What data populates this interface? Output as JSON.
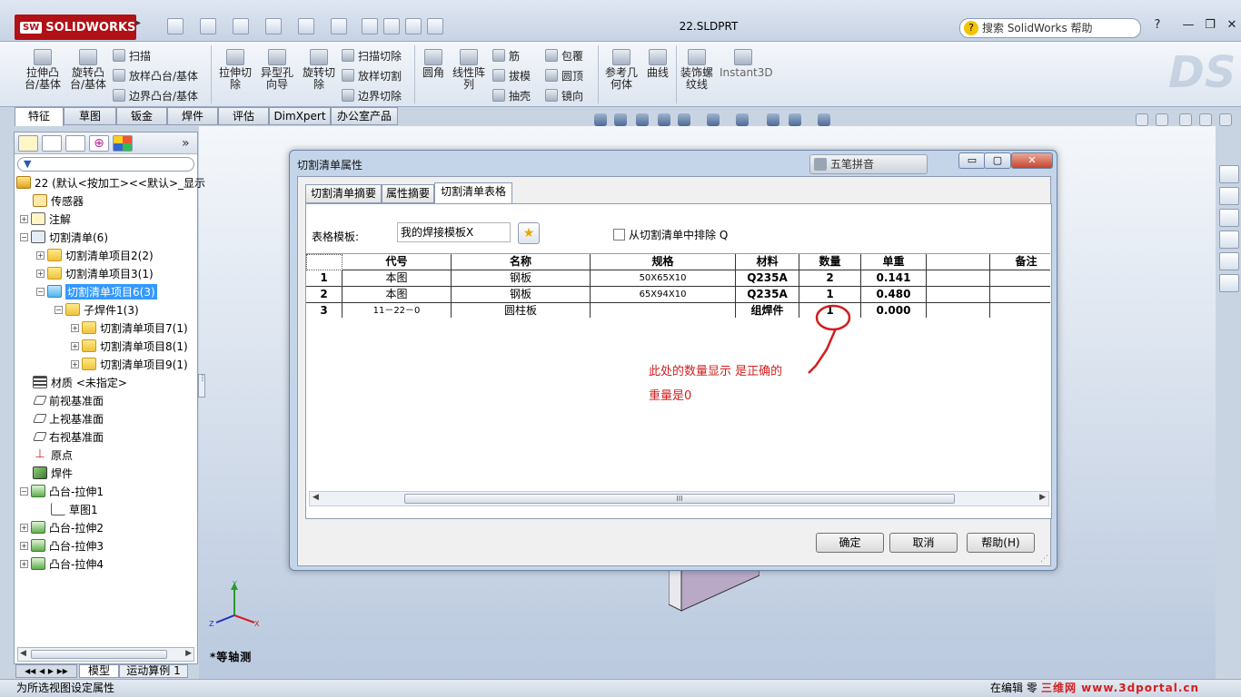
{
  "app": {
    "logo": "SOLIDWORKS",
    "logo_mark": "SW",
    "document_title": "22.SLDPRT",
    "help_search_placeholder": "搜索 SolidWorks 帮助",
    "help_glyph": "?",
    "window_controls": [
      "—",
      "❐",
      "✕"
    ]
  },
  "command_manager": {
    "large": [
      {
        "label1": "拉伸凸",
        "label2": "台/基体"
      },
      {
        "label1": "旋转凸",
        "label2": "台/基体"
      },
      {
        "label1": "拉伸切",
        "label2": "除"
      },
      {
        "label1": "异型孔",
        "label2": "向导"
      },
      {
        "label1": "旋转切",
        "label2": "除"
      },
      {
        "label1": "圆角",
        "label2": ""
      },
      {
        "label1": "线性阵",
        "label2": "列"
      },
      {
        "label1": "参考几",
        "label2": "何体"
      },
      {
        "label1": "曲线",
        "label2": ""
      },
      {
        "label1": "装饰螺",
        "label2": "纹线"
      },
      {
        "label1": "Instant3D",
        "label2": ""
      }
    ],
    "small_group1": [
      "扫描",
      "放样凸台/基体",
      "边界凸台/基体"
    ],
    "small_group2": [
      "扫描切除",
      "放样切割",
      "边界切除"
    ],
    "small_group3": [
      "筋",
      "拔模",
      "抽壳"
    ],
    "small_group4": [
      "包覆",
      "圆顶",
      "镜向"
    ]
  },
  "tabs": [
    "特征",
    "草图",
    "钣金",
    "焊件",
    "评估",
    "DimXpert",
    "办公室产品"
  ],
  "feature_tree": {
    "root": "22 (默认<按加工><<默认>_显示",
    "expand_glyph": "»",
    "nodes": [
      {
        "label": "传感器"
      },
      {
        "label": "注解"
      },
      {
        "label": "切割清单(6)"
      },
      {
        "label": "切割清单项目2(2)"
      },
      {
        "label": "切割清单项目3(1)"
      },
      {
        "label": "切割清单项目6(3)"
      },
      {
        "label": "子焊件1(3)"
      },
      {
        "label": "切割清单项目7(1)"
      },
      {
        "label": "切割清单项目8(1)"
      },
      {
        "label": "切割清单项目9(1)"
      },
      {
        "label": "材质 <未指定>"
      },
      {
        "label": "前视基准面"
      },
      {
        "label": "上视基准面"
      },
      {
        "label": "右视基准面"
      },
      {
        "label": "原点"
      },
      {
        "label": "焊件"
      },
      {
        "label": "凸台-拉伸1"
      },
      {
        "label": "草图1"
      },
      {
        "label": "凸台-拉伸2"
      },
      {
        "label": "凸台-拉伸3"
      },
      {
        "label": "凸台-拉伸4"
      }
    ]
  },
  "bottom_tabs": [
    "模型",
    "运动算例 1"
  ],
  "status": {
    "left": "为所选视图设定属性",
    "right": "在编辑 零"
  },
  "watermark": "三维网 www.3dportal.cn",
  "view": {
    "name": "*等轴测",
    "axis_x": "X",
    "axis_y": "Y",
    "axis_z": "Z"
  },
  "dialog": {
    "title": "切割清单属性",
    "ime_label": "五笔拼音",
    "tabs": [
      "切割清单摘要",
      "属性摘要",
      "切割清单表格"
    ],
    "template_label": "表格模板:",
    "template_value": "我的焊接模板X",
    "exclude_label": "从切割清单中排除 Q",
    "columns": [
      "代号",
      "名称",
      "规格",
      "材料",
      "数量",
      "单重",
      "",
      "备注"
    ],
    "rows": [
      {
        "num": "1",
        "code": "本图",
        "name": "钢板",
        "spec": "50X65X10",
        "material": "Q235A",
        "qty": "2",
        "weight": "0.141"
      },
      {
        "num": "2",
        "code": "本图",
        "name": "钢板",
        "spec": "65X94X10",
        "material": "Q235A",
        "qty": "1",
        "weight": "0.480"
      },
      {
        "num": "3",
        "code": "11－22－0",
        "name": "圆柱板",
        "spec": "",
        "material": "组焊件",
        "qty": "1",
        "weight": "0.000"
      }
    ],
    "scroll_grip": "III",
    "ok": "确定",
    "cancel": "取消",
    "help": "帮助(H)"
  },
  "annotation": {
    "line1": "此处的数量显示 是正确的",
    "line2": "重量是0",
    "color": "#d01e1e"
  }
}
